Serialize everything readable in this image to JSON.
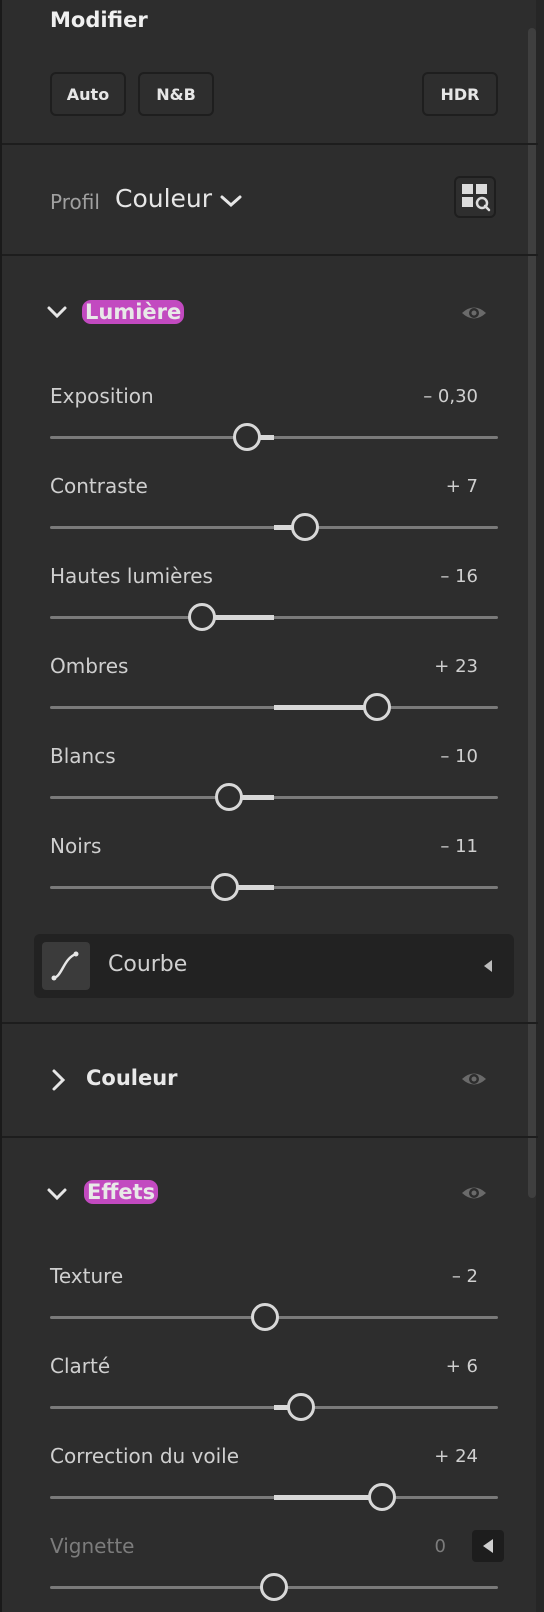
{
  "header": {
    "title": "Modifier",
    "buttons": [
      "Auto",
      "N&B",
      "HDR"
    ]
  },
  "profile": {
    "label": "Profil",
    "value": "Couleur"
  },
  "sections": {
    "light": "Lumière",
    "color": "Couleur",
    "effects": "Effets"
  },
  "light": [
    {
      "label": "Exposition",
      "value": "– 0,30",
      "level": -0.06
    },
    {
      "label": "Contraste",
      "value": "+ 7",
      "level": 0.07
    },
    {
      "label": "Hautes lumières",
      "value": "– 16",
      "level": -0.16
    },
    {
      "label": "Ombres",
      "value": "+ 23",
      "level": 0.23
    },
    {
      "label": "Blancs",
      "value": "– 10",
      "level": -0.1
    },
    {
      "label": "Noirs",
      "value": "– 11",
      "level": -0.11
    }
  ],
  "curve": {
    "label": "Courbe"
  },
  "effects": [
    {
      "label": "Texture",
      "value": "– 2",
      "level": -0.02
    },
    {
      "label": "Clarté",
      "value": "+ 6",
      "level": 0.06
    },
    {
      "label": "Correction du voile",
      "value": "+ 24",
      "level": 0.24
    },
    {
      "label": "Vignette",
      "value": "0",
      "level": 0
    }
  ],
  "icons": [
    "chevron-down-icon",
    "chevron-right-icon",
    "eye-icon",
    "profile-browser-icon",
    "curve-icon",
    "triangle-left-icon"
  ]
}
